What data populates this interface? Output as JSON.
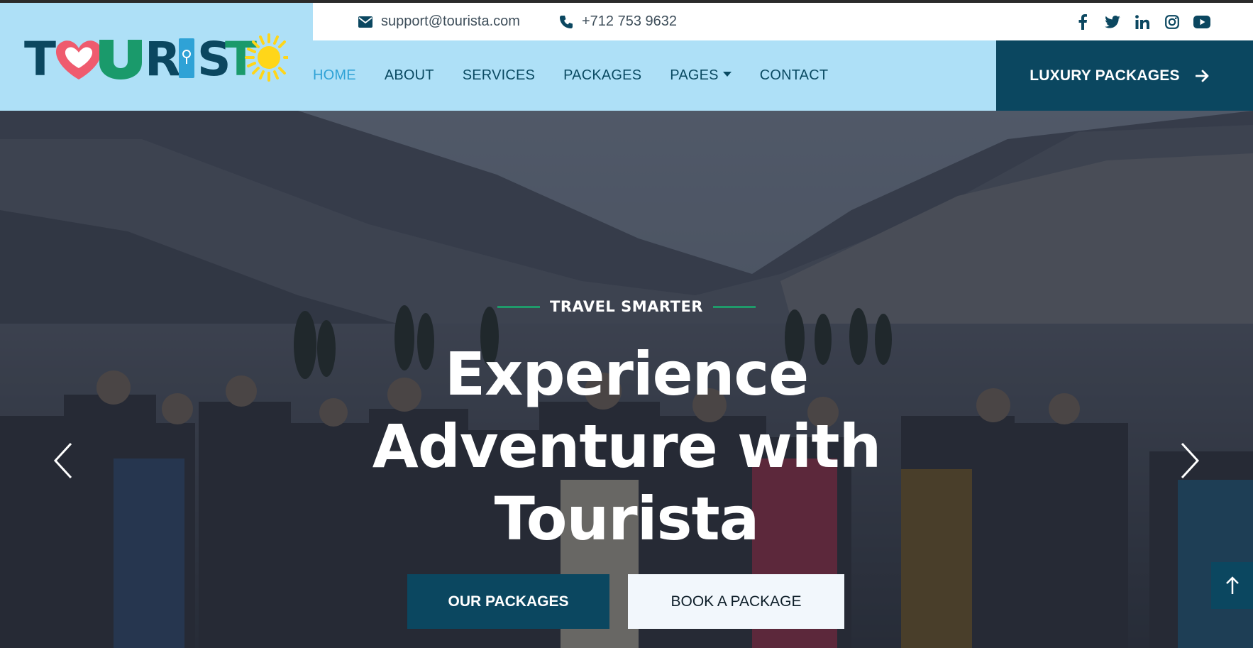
{
  "brand": {
    "logo_text": "TOURISTA",
    "colors": {
      "navy": "#0b4760",
      "sky": "#aee0f7",
      "heart": "#ef5b6e",
      "green": "#1a9a6b",
      "blue": "#2fa2d6",
      "sun": "#ffd619"
    }
  },
  "topbar": {
    "email": "support@tourista.com",
    "email_icon": "envelope-icon",
    "phone": "+712 753 9632",
    "phone_icon": "phone-icon",
    "socials": [
      "facebook-icon",
      "twitter-icon",
      "linkedin-icon",
      "instagram-icon",
      "youtube-icon"
    ]
  },
  "nav": {
    "items": [
      {
        "label": "HOME",
        "active": true
      },
      {
        "label": "ABOUT",
        "active": false
      },
      {
        "label": "SERVICES",
        "active": false
      },
      {
        "label": "PACKAGES",
        "active": false
      },
      {
        "label": "PAGES",
        "active": false,
        "dropdown": true
      },
      {
        "label": "CONTACT",
        "active": false
      }
    ],
    "cta_label": "LUXURY PACKAGES",
    "cta_icon": "arrow-right-icon"
  },
  "hero": {
    "eyebrow": "TRAVEL SMARTER",
    "headline": {
      "line1": "Experience",
      "line2": "Adventure with",
      "line3": "Tourista"
    },
    "primary_button": "OUR PACKAGES",
    "secondary_button": "BOOK A PACKAGE",
    "prev_icon": "chevron-left-icon",
    "next_icon": "chevron-right-icon",
    "scroll_top_icon": "arrow-up-icon"
  }
}
